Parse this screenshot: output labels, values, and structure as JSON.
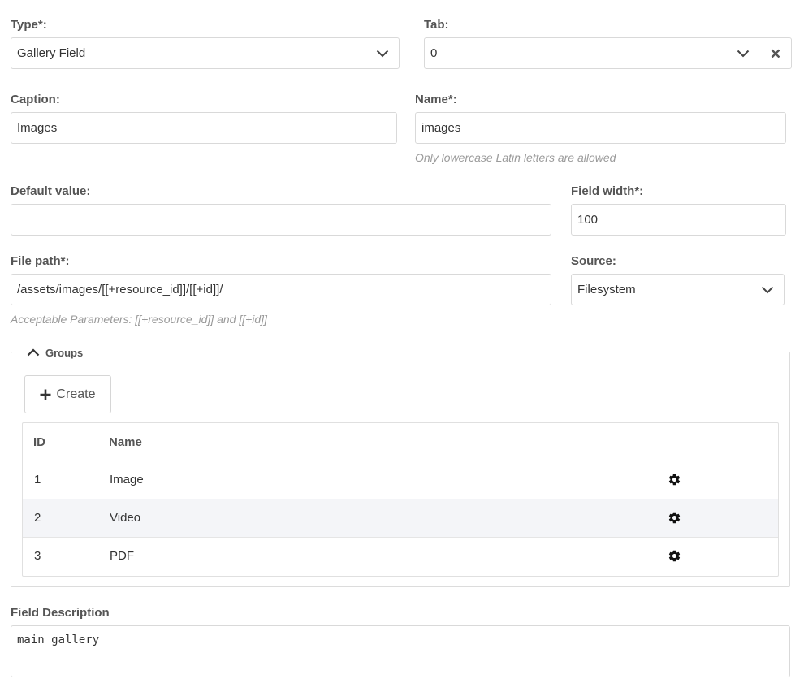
{
  "type": {
    "label": "Type*:",
    "value": "Gallery Field"
  },
  "tab": {
    "label": "Tab:",
    "value": "0"
  },
  "caption": {
    "label": "Caption:",
    "value": "Images"
  },
  "name": {
    "label": "Name*:",
    "value": "images",
    "hint": "Only lowercase Latin letters are allowed"
  },
  "default_value": {
    "label": "Default value:",
    "value": ""
  },
  "field_width": {
    "label": "Field width*:",
    "value": "100"
  },
  "file_path": {
    "label": "File path*:",
    "value": "/assets/images/[[+resource_id]]/[[+id]]/",
    "hint": "Acceptable Parameters: [[+resource_id]] and [[+id]]"
  },
  "source": {
    "label": "Source:",
    "value": "Filesystem"
  },
  "groups": {
    "legend": "Groups",
    "create_label": "Create",
    "columns": {
      "id": "ID",
      "name": "Name"
    },
    "rows": [
      {
        "id": "1",
        "name": "Image"
      },
      {
        "id": "2",
        "name": "Video"
      },
      {
        "id": "3",
        "name": "PDF"
      }
    ]
  },
  "description": {
    "label": "Field Description",
    "value": "main gallery"
  },
  "icons": {
    "dropdown": "chevron-down-icon",
    "clear": "close-icon",
    "collapse": "chevron-up-icon",
    "create": "plus-icon",
    "row_action": "gear-icon"
  }
}
